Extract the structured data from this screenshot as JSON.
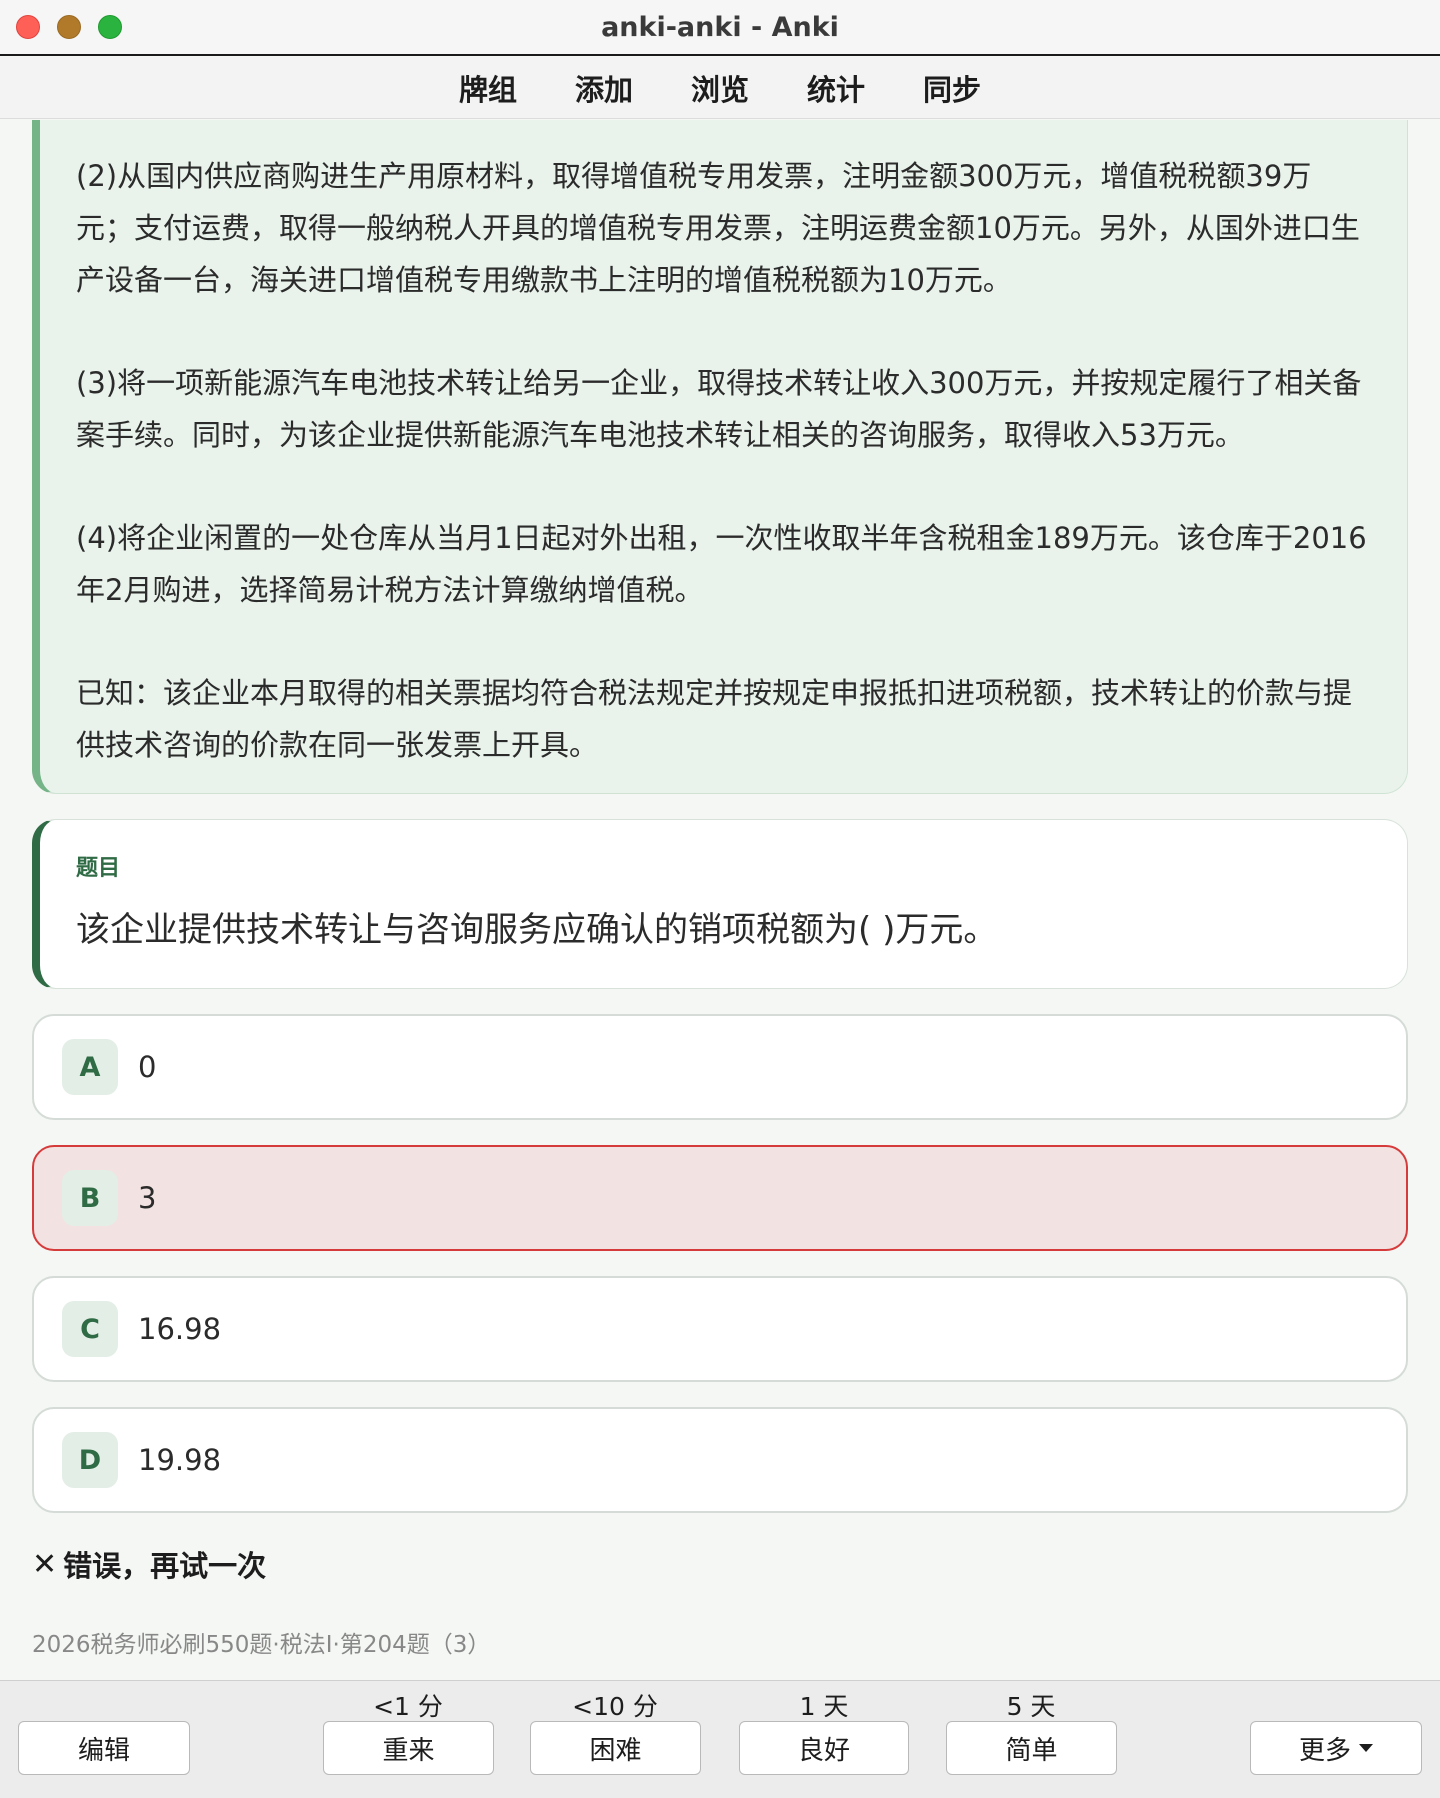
{
  "window": {
    "title": "anki-anki - Anki"
  },
  "nav": {
    "decks": "牌组",
    "add": "添加",
    "browse": "浏览",
    "stats": "统计",
    "sync": "同步"
  },
  "passage": {
    "p2": "(2)从国内供应商购进生产用原材料，取得增值税专用发票，注明金额300万元，增值税税额39万元；支付运费，取得一般纳税人开具的增值税专用发票，注明运费金额10万元。另外，从国外进口生产设备一台，海关进口增值税专用缴款书上注明的增值税税额为10万元。",
    "p3": "(3)将一项新能源汽车电池技术转让给另一企业，取得技术转让收入300万元，并按规定履行了相关备案手续。同时，为该企业提供新能源汽车电池技术转让相关的咨询服务，取得收入53万元。",
    "p4": "(4)将企业闲置的一处仓库从当月1日起对外出租，一次性收取半年含税租金189万元。该仓库于2016年2月购进，选择简易计税方法计算缴纳增值税。",
    "known": "已知：该企业本月取得的相关票据均符合税法规定并按规定申报抵扣进项税额，技术转让的价款与提供技术咨询的价款在同一张发票上开具。"
  },
  "question": {
    "label": "题目",
    "text": "该企业提供技术转让与咨询服务应确认的销项税额为( )万元。"
  },
  "options": [
    {
      "letter": "A",
      "text": "0",
      "state": "normal"
    },
    {
      "letter": "B",
      "text": "3",
      "state": "wrong"
    },
    {
      "letter": "C",
      "text": "16.98",
      "state": "normal"
    },
    {
      "letter": "D",
      "text": "19.98",
      "state": "normal"
    }
  ],
  "feedback": {
    "icon": "✕",
    "text": "错误，再试一次"
  },
  "source": "2026税务师必刷550题·税法I·第204题（3）",
  "bottom": {
    "edit": "编辑",
    "again": {
      "label": "重来",
      "due": "<1 分"
    },
    "hard": {
      "label": "困难",
      "due": "<10 分"
    },
    "good": {
      "label": "良好",
      "due": "1 天"
    },
    "easy": {
      "label": "简单",
      "due": "5 天"
    },
    "more": "更多"
  },
  "colors": {
    "accent": "#2f6b44",
    "passage_bg": "#e9f3ec",
    "passage_border": "#75b487",
    "wrong_bg": "#f2e2e1",
    "wrong_border": "#d63b3b"
  }
}
